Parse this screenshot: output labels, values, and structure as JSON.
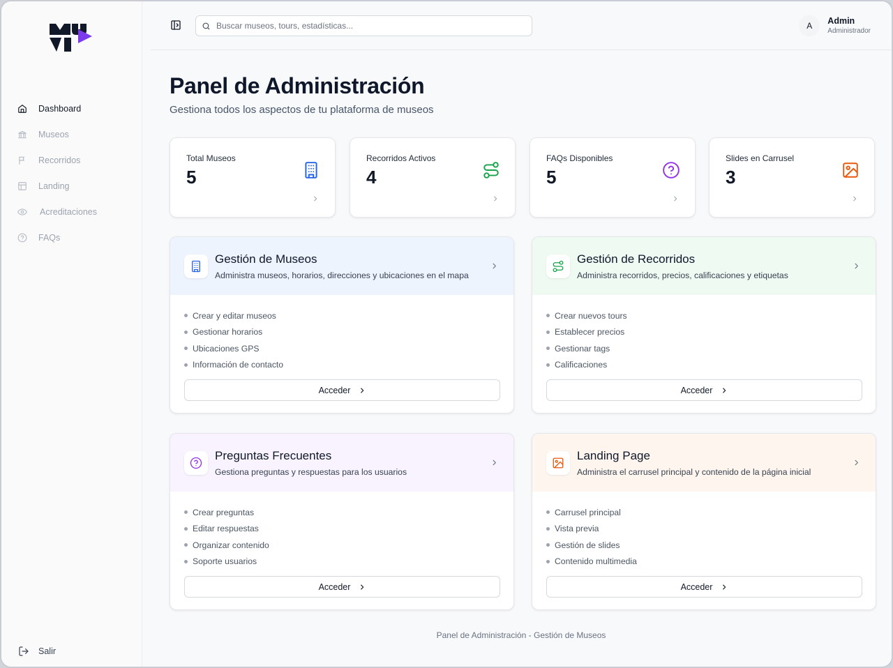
{
  "app": {
    "logo_alt": "MUVI",
    "brand_colors": {
      "dark": "#111827",
      "accent": "#7c3aed"
    }
  },
  "sidebar": {
    "items": [
      {
        "label": "Dashboard",
        "icon": "home-icon",
        "active": true
      },
      {
        "label": "Museos",
        "icon": "museum-icon",
        "active": false
      },
      {
        "label": "Recorridos",
        "icon": "flag-icon",
        "active": false
      },
      {
        "label": "Landing",
        "icon": "layout-icon",
        "active": false
      },
      {
        "label": "Acreditaciones",
        "icon": "eye-icon",
        "active": false
      },
      {
        "label": "FAQs",
        "icon": "help-circle-icon",
        "active": false
      }
    ],
    "logout_label": "Salir"
  },
  "topbar": {
    "search_placeholder": "Buscar museos, tours, estadísticas...",
    "user": {
      "initial": "A",
      "name": "Admin",
      "role": "Administrador"
    }
  },
  "page": {
    "title": "Panel de Administración",
    "subtitle": "Gestiona todos los aspectos de tu plataforma de museos"
  },
  "stats": [
    {
      "label": "Total Museos",
      "value": "5",
      "icon": "building-icon",
      "color": "#2563eb"
    },
    {
      "label": "Recorridos Activos",
      "value": "4",
      "icon": "route-icon",
      "color": "#16a34a"
    },
    {
      "label": "FAQs Disponibles",
      "value": "5",
      "icon": "help-circle-icon",
      "color": "#9333ea"
    },
    {
      "label": "Slides en Carrusel",
      "value": "3",
      "icon": "image-icon",
      "color": "#ea580c"
    }
  ],
  "cards": [
    {
      "title": "Gestión de Museos",
      "description": "Administra museos, horarios, direcciones y ubicaciones en el mapa",
      "items": [
        "Crear y editar museos",
        "Gestionar horarios",
        "Ubicaciones GPS",
        "Información de contacto"
      ],
      "button": "Acceder",
      "icon": "building-icon",
      "color": "#2563eb",
      "bg": "#eef4fe"
    },
    {
      "title": "Gestión de Recorridos",
      "description": "Administra recorridos, precios, calificaciones y etiquetas",
      "items": [
        "Crear nuevos tours",
        "Establecer precios",
        "Gestionar tags",
        "Calificaciones"
      ],
      "button": "Acceder",
      "icon": "route-icon",
      "color": "#16a34a",
      "bg": "#eefaf2"
    },
    {
      "title": "Preguntas Frecuentes",
      "description": "Gestiona preguntas y respuestas para los usuarios",
      "items": [
        "Crear preguntas",
        "Editar respuestas",
        "Organizar contenido",
        "Soporte usuarios"
      ],
      "button": "Acceder",
      "icon": "help-circle-icon",
      "color": "#9333ea",
      "bg": "#f8f3fe"
    },
    {
      "title": "Landing Page",
      "description": "Administra el carrusel principal y contenido de la página inicial",
      "items": [
        "Carrusel principal",
        "Vista previa",
        "Gestión de slides",
        "Contenido multimedia"
      ],
      "button": "Acceder",
      "icon": "image-icon",
      "color": "#ea580c",
      "bg": "#fef6ee"
    }
  ],
  "footer": {
    "text": "Panel de Administración - Gestión de Museos"
  }
}
